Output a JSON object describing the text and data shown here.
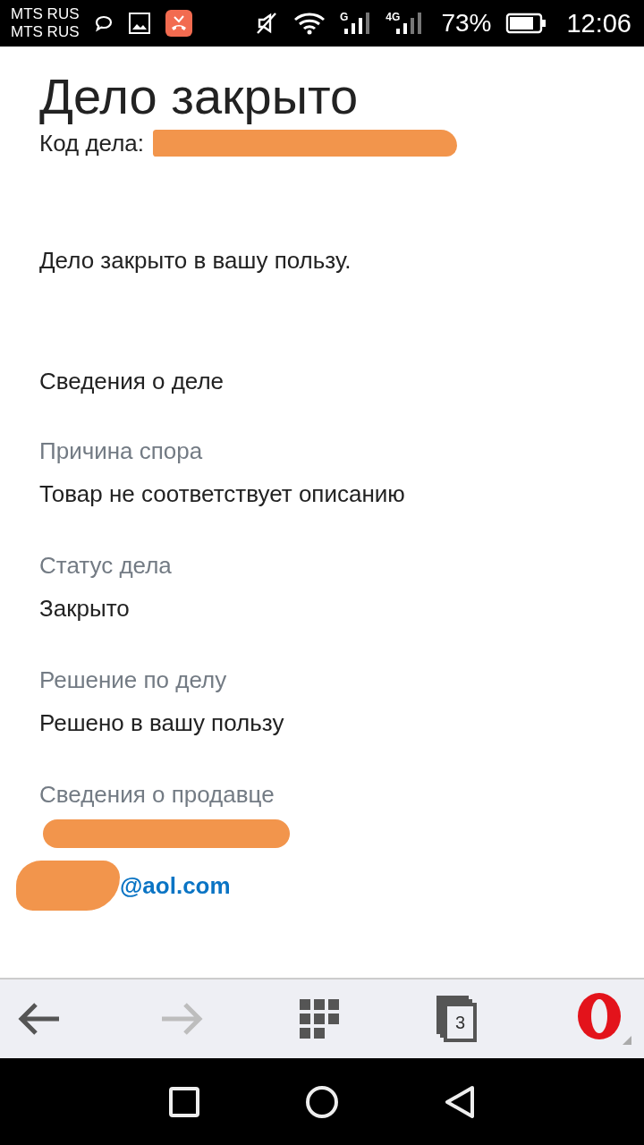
{
  "status_bar": {
    "carriers": [
      "MTS RUS",
      "MTS RUS"
    ],
    "signal_labels": [
      "G",
      "4G"
    ],
    "battery": "73%",
    "time": "12:06"
  },
  "page": {
    "title": "Дело закрыто",
    "case_code": {
      "label": "Код дела:",
      "redacted": true
    },
    "message": "Дело закрыто в вашу пользу.",
    "section_title": "Сведения о деле",
    "details": [
      {
        "label": "Причина спора",
        "value": "Товар не соответствует описанию"
      },
      {
        "label": "Статус дела",
        "value": "Закрыто"
      },
      {
        "label": "Решение по делу",
        "value": "Решено в вашу пользу"
      }
    ],
    "seller": {
      "label": "Сведения о продавце",
      "name_redacted": true,
      "email": "@aol.com",
      "email_redacted": true
    }
  },
  "toolbar": {
    "forward_disabled": true,
    "tab_count": "3"
  }
}
